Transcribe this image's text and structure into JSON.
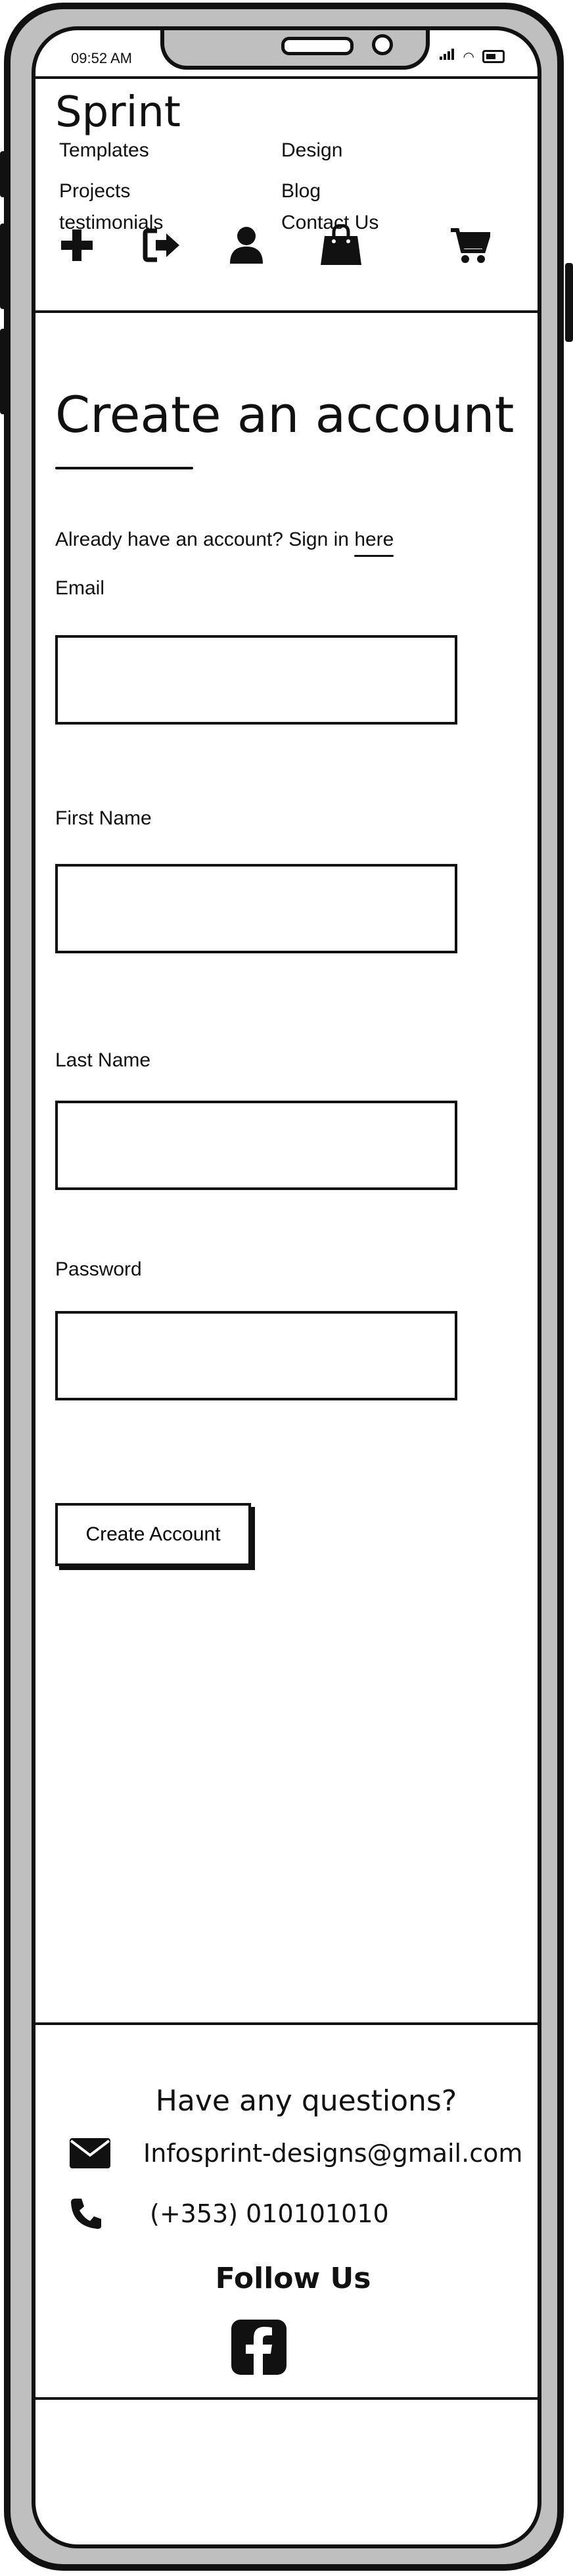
{
  "status_bar": {
    "time": "09:52 AM"
  },
  "header": {
    "brand": "Sprint",
    "nav": {
      "templates": "Templates",
      "design": "Design",
      "projects": "Projects",
      "blog": "Blog",
      "testimonials": "testimonials",
      "contact": "Contact Us"
    },
    "icons": [
      "plus-icon",
      "sign-in-icon",
      "user-icon",
      "shopping-bag-icon",
      "cart-icon"
    ]
  },
  "main": {
    "title": "Create an account",
    "signin_prompt": "Already have an account? Sign in ",
    "signin_link": "here",
    "fields": {
      "email_label": "Email",
      "first_name_label": "First Name",
      "last_name_label": "Last Name",
      "password_label": "Password"
    },
    "submit_label": "Create Account"
  },
  "footer": {
    "heading": "Have any questions?",
    "email": "Infosprint-designs@gmail.com",
    "phone": "(+353) 010101010",
    "follow_heading": "Follow Us",
    "social_icon": "facebook-icon"
  }
}
